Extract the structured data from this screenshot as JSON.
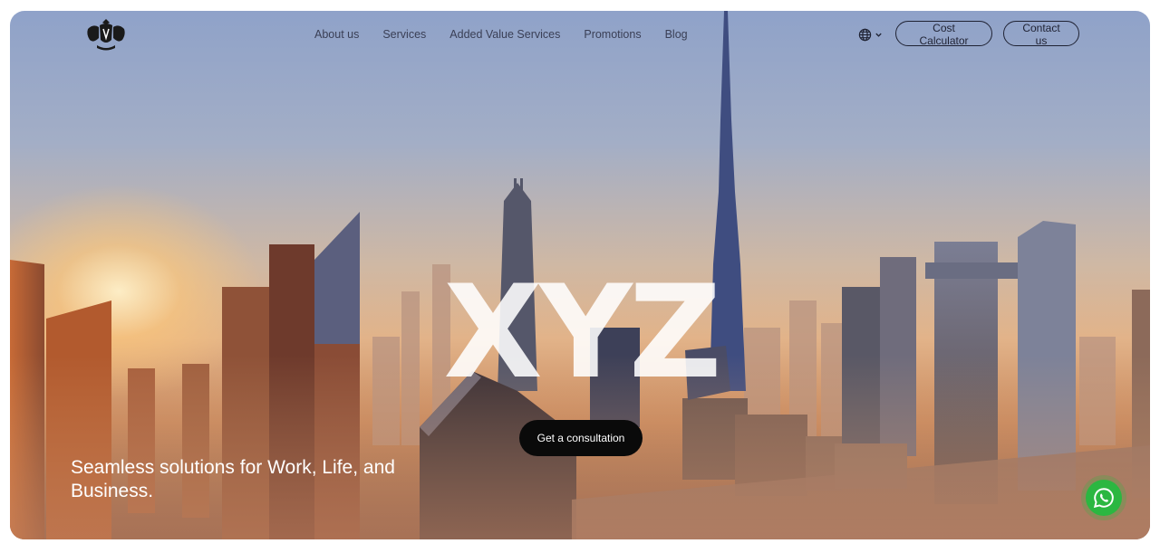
{
  "nav": {
    "logo_icon": "lion-crest-icon",
    "links": [
      {
        "label": "About us"
      },
      {
        "label": "Services"
      },
      {
        "label": "Added Value Services"
      },
      {
        "label": "Promotions"
      },
      {
        "label": "Blog"
      }
    ],
    "language_icon": "globe-icon",
    "cost_calculator_label": "Cost Calculator",
    "contact_label": "Contact us"
  },
  "hero": {
    "brand_text": "XYZ",
    "cta_label": "Get a consultation",
    "tagline": "Seamless solutions for Work, Life, and Business.",
    "background": "city-skyline-sunrise-photo"
  },
  "floating": {
    "whatsapp_icon": "whatsapp-icon",
    "whatsapp_color": "#2bb741"
  },
  "colors": {
    "cta_bg": "#0a0a0a",
    "nav_text": "#3a3f55"
  }
}
